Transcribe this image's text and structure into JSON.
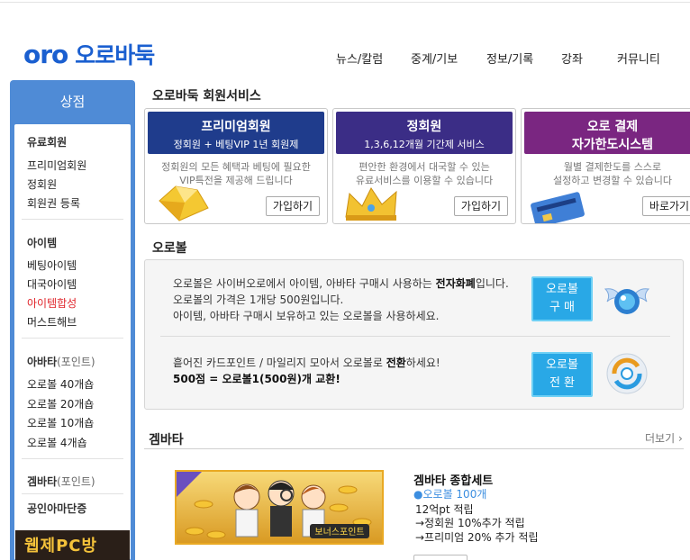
{
  "header": {
    "logo_mark": "oro",
    "logo_text": "오로바둑",
    "nav": [
      "뉴스/칼럼",
      "중계/기보",
      "정보/기록",
      "강좌",
      "커뮤니티"
    ]
  },
  "sidebar": {
    "title": "상점",
    "sections": [
      {
        "title": "유료회원",
        "items": [
          "프리미엄회원",
          "정회원",
          "회원권 등록"
        ]
      },
      {
        "title": "아이템",
        "items": [
          "베팅아이템",
          "대국아이템",
          "아이템합성",
          "머스트해브"
        ],
        "active": "아이템합성"
      },
      {
        "title": "아바타",
        "title_sub": "(포인트)",
        "items": [
          "오로볼 40개숍",
          "오로볼 20개숍",
          "오로볼 10개숍",
          "오로볼 4개숍"
        ]
      },
      {
        "title": "겜바타",
        "title_sub": "(포인트)"
      },
      {
        "title": "공인아마단증"
      }
    ],
    "banner": "웹제PC방"
  },
  "membership": {
    "heading": "오로바둑 회원서비스",
    "cards": [
      {
        "title": "프리미엄회원",
        "subtitle": "정회원 + 베팅VIP 1년 회원제",
        "desc": [
          "정회원의 모든 혜택과 베팅에 필요한",
          "VIP특전을 제공해 드립니다"
        ],
        "button": "가입하기",
        "color": "#1f3c8c"
      },
      {
        "title": "정회원",
        "subtitle": "1,3,6,12개월 기간제 서비스",
        "desc": [
          "편안한 환경에서 대국할 수 있는",
          "유료서비스를 이용할 수 있습니다"
        ],
        "button": "가입하기",
        "color": "#3b2d86"
      },
      {
        "title": "오로 결제",
        "subtitle": "자가한도시스템",
        "desc": [
          "월별 결제한도를 스스로",
          "설정하고 변경할 수 있습니다"
        ],
        "button": "바로가기",
        "color": "#7a2681"
      }
    ]
  },
  "orobal": {
    "heading": "오로볼",
    "info": {
      "line1_pre": "오로볼은 사이버오로에서 아이템, 아바타 구매시 사용하는 ",
      "line1_bold": "전자화폐",
      "line1_post": "입니다.",
      "line2": "오로볼의 가격은 1개당 500원입니다.",
      "line3": "아이템, 아바타 구매시 보유하고 있는 오로볼을 사용하세요."
    },
    "buy_button": [
      "오로볼",
      "구 매"
    ],
    "exchange": {
      "line1_pre": "흩어진 카드포인트 / 마일리지 모아서 오로볼로 ",
      "line1_bold": "전환",
      "line1_post": "하세요!",
      "line2": "500점 = 오로볼1(500원)개 교환!"
    },
    "exchange_button": [
      "오로볼",
      "전 환"
    ]
  },
  "gembata": {
    "heading": "겜바타",
    "more": "더보기",
    "product": {
      "name": "겜바타 종합세트",
      "price": "오로볼 100개",
      "lines": [
        "12억pt 적립",
        "→정회원 10%추가 적립",
        "→프리미엄 20% 추가 적립"
      ],
      "badge": "보너스포인트"
    }
  },
  "colors": {
    "accent": "#1a5fd0",
    "sidebar": "#4f8bd6",
    "active": "#e0242a",
    "button": "#29a8e6"
  }
}
